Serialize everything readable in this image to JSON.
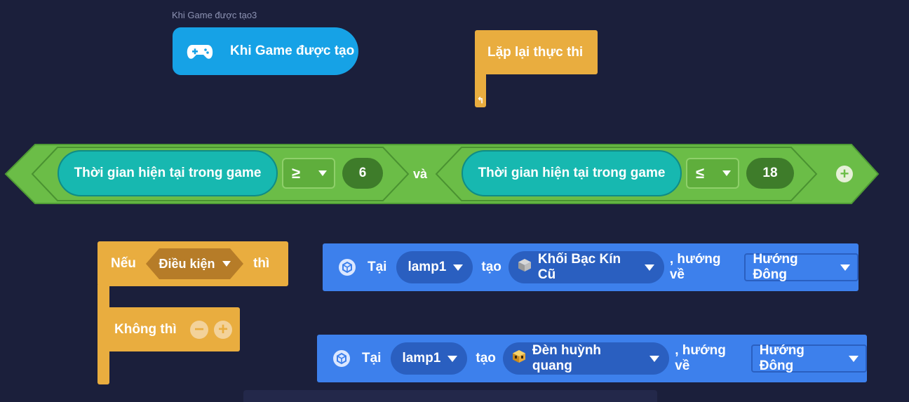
{
  "canvas": {
    "background": "#1b1f3b"
  },
  "event_block": {
    "caption": "Khi Game được tạo3",
    "label": "Khi Game được tạo",
    "icon": "gamepad-icon",
    "color": "#16a2e6"
  },
  "loop_block": {
    "label": "Lặp lại thực thi",
    "color": "#e9ad3f",
    "icon": "loop-return-icon"
  },
  "condition_block": {
    "color": "#6bbd47",
    "left": {
      "getter": "Thời gian hiện tại trong game",
      "operator": "≥",
      "value": "6"
    },
    "joiner": "và",
    "right": {
      "getter": "Thời gian hiện tại trong game",
      "operator": "≤",
      "value": "18"
    },
    "add_icon": "plus-icon"
  },
  "if_block": {
    "if_label": "Nếu",
    "condition_placeholder": "Điều kiện",
    "then_label": "thì",
    "else_label": "Không thì",
    "color": "#e9ad3f"
  },
  "create_blocks": [
    {
      "at_label": "Tại",
      "target": "lamp1",
      "create_label": "tạo",
      "block_icon": "silver-block-icon",
      "block_name": "Khối Bạc Kín Cũ",
      "facing_label": ", hướng về",
      "direction": "Hướng Đông"
    },
    {
      "at_label": "Tại",
      "target": "lamp1",
      "create_label": "tạo",
      "block_icon": "lamp-block-icon",
      "block_name": "Đèn huỳnh quang",
      "facing_label": ", hướng về",
      "direction": "Hướng Đông"
    }
  ],
  "colors": {
    "create_block": "#3d80ec",
    "dropdown": "#2a5fc0",
    "getter": "#17b8b0",
    "number": "#3e7c2a"
  }
}
